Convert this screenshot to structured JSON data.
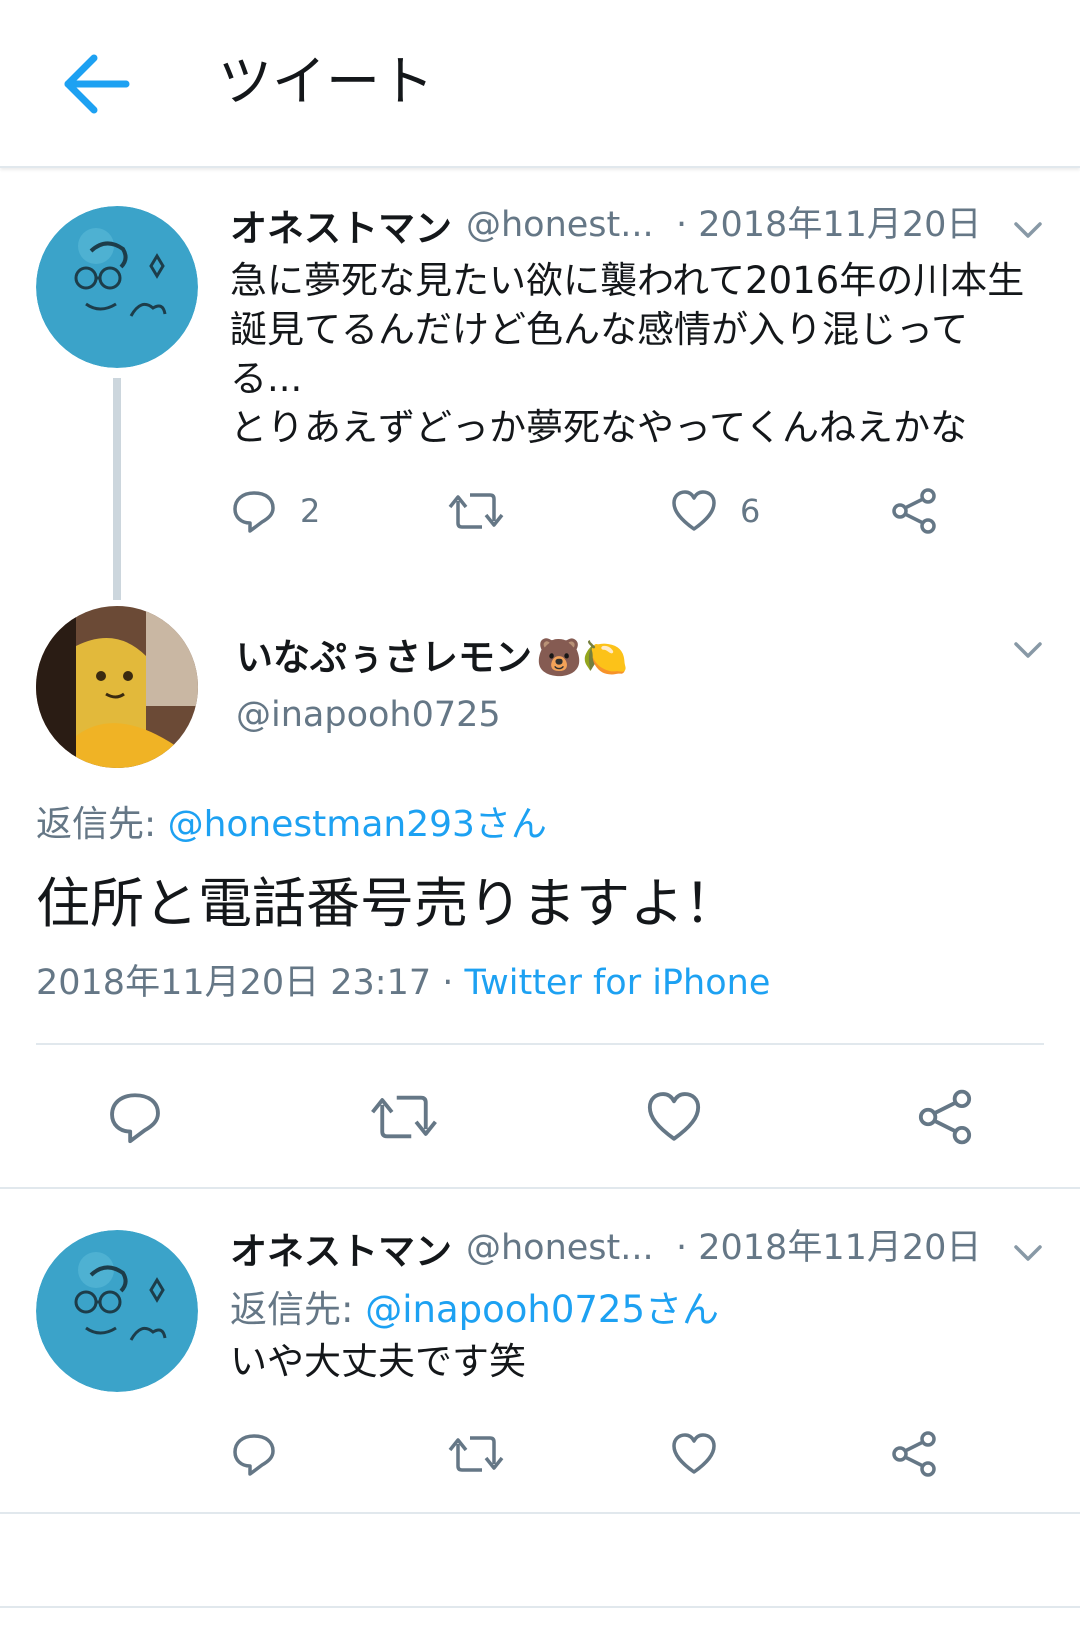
{
  "header": {
    "title": "ツイート"
  },
  "tweet1": {
    "name": "オネストマン",
    "handle": "@honest...",
    "date": "· 2018年11月20日",
    "lines": [
      "急に夢死な見たい欲に襲われて2016年の川本生",
      "誕見てるんだけど色んな感情が入り混じって",
      "る...",
      "とりあえずどっか夢死なやってくんねえかな"
    ],
    "reply_count": "2",
    "like_count": "6"
  },
  "main_tweet": {
    "name": "いなぷぅさレモン",
    "name_emoji": "🐻🍋",
    "handle": "@inapooh0725",
    "replying_prefix": "返信先: ",
    "replying_to": "@honestman293さん",
    "text": "住所と電話番号売りますよ！",
    "timestamp": "2018年11月20日 23:17",
    "separator": " · ",
    "source": "Twitter for iPhone"
  },
  "tweet2": {
    "name": "オネストマン",
    "handle": "@honest...",
    "date": "· 2018年11月20日",
    "replying_prefix": "返信先: ",
    "replying_to": "@inapooh0725さん",
    "text": "いや大丈夫です笑"
  },
  "colors": {
    "accent": "#1da1f2",
    "secondary_text": "#657786",
    "icon": "#657786",
    "thread_line": "#ccd6dd"
  }
}
